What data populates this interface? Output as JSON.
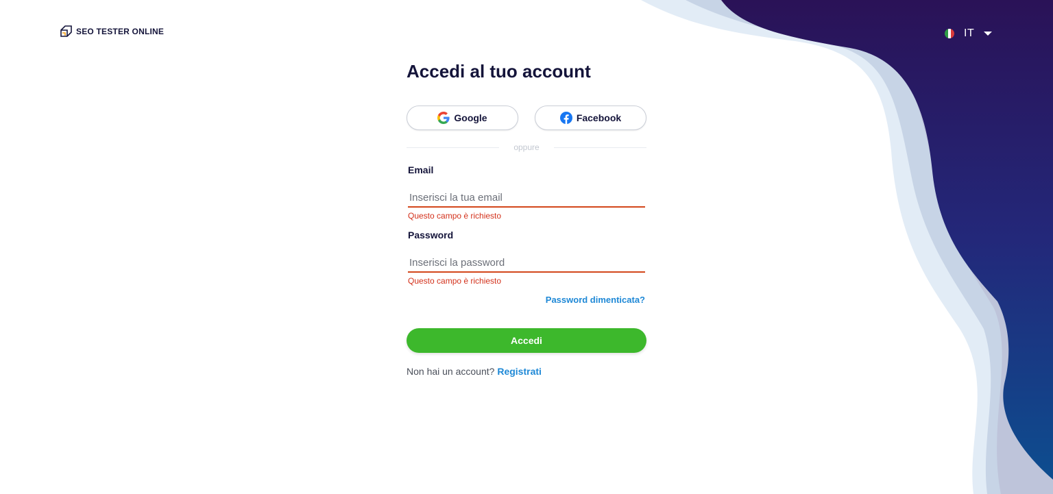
{
  "brand": {
    "name": "SEO TESTER ONLINE",
    "icon": "cube-logo-icon",
    "accent_color": "#f39c12"
  },
  "language": {
    "code": "IT",
    "flag_icon": "italy-flag-icon"
  },
  "login": {
    "title": "Accedi al tuo account",
    "google_label": "Google",
    "facebook_label": "Facebook",
    "divider_text": "oppure",
    "email": {
      "label": "Email",
      "placeholder": "Inserisci la tua email",
      "value": "",
      "error": "Questo campo è richiesto"
    },
    "password": {
      "label": "Password",
      "placeholder": "Inserisci la password",
      "value": "",
      "error": "Questo campo è richiesto"
    },
    "forgot_label": "Password dimenticata?",
    "submit_label": "Accedi",
    "signup_prompt": "Non hai un account?",
    "signup_link": "Registrati"
  },
  "colors": {
    "primary_button": "#3db82c",
    "link": "#1e88d6",
    "error": "#d3301a",
    "dark_navy": "#2a1257",
    "deep_blue": "#0d4d8f"
  }
}
